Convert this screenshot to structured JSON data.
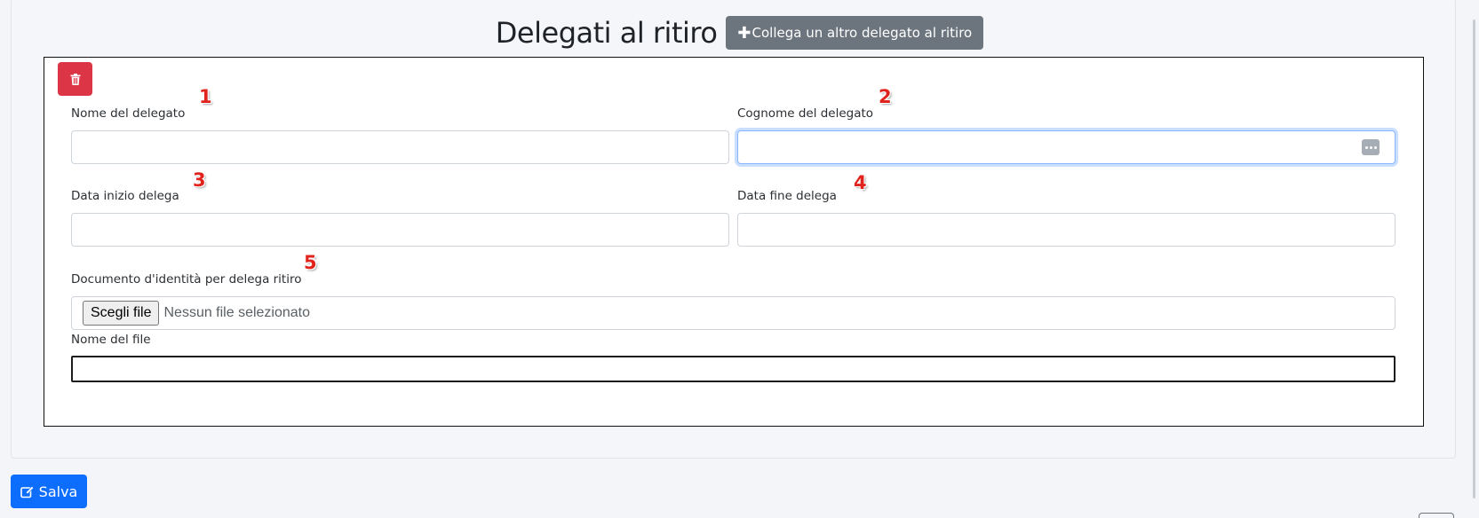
{
  "header": {
    "title": "Delegati al ritiro",
    "add_delegate_label": "Collega un altro delegato al ritiro",
    "add_delegate_icon": "plus-icon"
  },
  "delegate_form": {
    "delete_icon": "trash-icon",
    "first_name": {
      "label": "Nome del delegato",
      "value": "",
      "annotation": "1"
    },
    "last_name": {
      "label": "Cognome del delegato",
      "value": "",
      "annotation": "2",
      "focused": true
    },
    "start_date": {
      "label": "Data inizio delega",
      "value": "",
      "annotation": "3"
    },
    "end_date": {
      "label": "Data fine delega",
      "value": "",
      "annotation": "4"
    },
    "id_document": {
      "label": "Documento d'identità per delega ritiro",
      "annotation": "5",
      "choose_label": "Scegli file",
      "status": "Nessun file selezionato"
    },
    "file_name": {
      "label": "Nome del file",
      "value": ""
    }
  },
  "footer": {
    "save_label": "Salva",
    "save_icon": "edit-icon"
  },
  "colors": {
    "danger": "#dc3545",
    "primary": "#0d6efd",
    "secondary": "#6c757d",
    "annotation": "#e0241d"
  }
}
